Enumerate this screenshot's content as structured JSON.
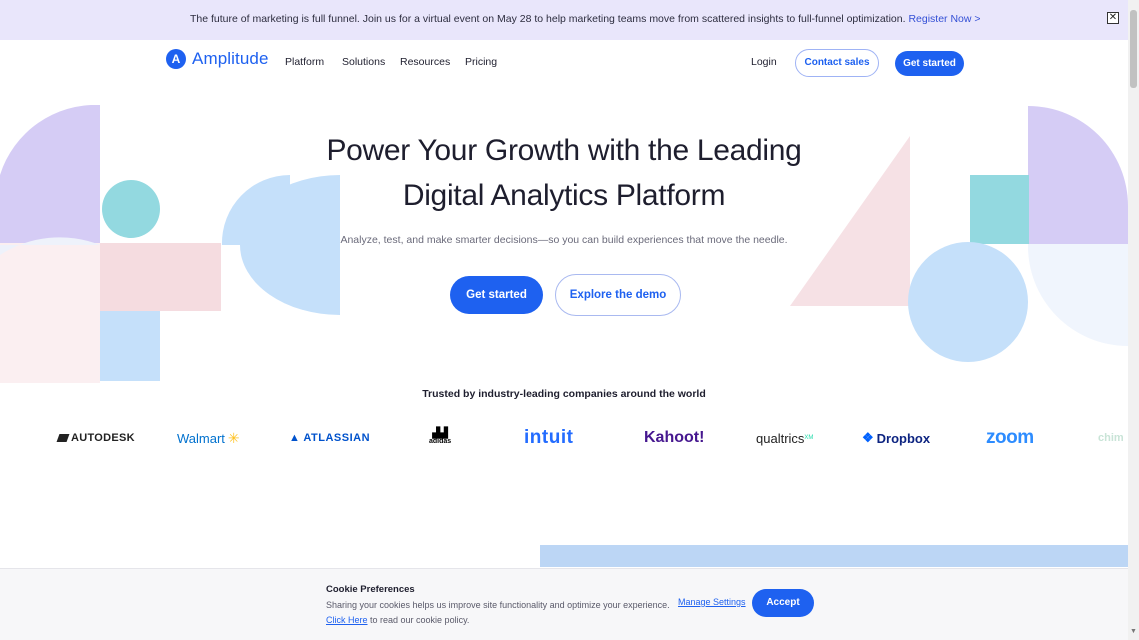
{
  "banner": {
    "text": "The future of marketing is full funnel. Join us for a virtual event on May 28 to help marketing teams move from scattered insights to full-funnel optimization.",
    "link": "Register Now >",
    "close_icon": "close-icon"
  },
  "nav": {
    "logo_mark": "A",
    "logo_text": "Amplitude",
    "items": [
      "Platform",
      "Solutions",
      "Resources",
      "Pricing"
    ],
    "login": "Login",
    "contact_sales": "Contact sales",
    "get_started": "Get started"
  },
  "hero": {
    "title_line1": "Power Your Growth with the Leading",
    "title_line2": "Digital Analytics Platform",
    "subtitle": "Analyze, test, and make smarter decisions—so you can build experiences that move the needle.",
    "primary_cta": "Get started",
    "secondary_cta": "Explore the demo"
  },
  "trusted": {
    "heading": "Trusted by industry-leading companies around the world",
    "logos": [
      "AUTODESK",
      "Walmart",
      "ATLASSIAN",
      "adidas",
      "intuit",
      "Kahoot!",
      "qualtrics",
      "Dropbox",
      "zoom",
      "chime"
    ]
  },
  "cookie": {
    "title": "Cookie Preferences",
    "text": "Sharing your cookies helps us improve site functionality and optimize your experience.",
    "link": "Click Here",
    "text_after_link": " to read our cookie policy.",
    "manage": "Manage Settings",
    "accept": "Accept"
  },
  "colors": {
    "brand_blue": "#1e61f0",
    "lavender": "#c9c2f2",
    "teal": "#93d9e0",
    "sky": "#c5e0fa",
    "pink": "#f5dce0"
  }
}
